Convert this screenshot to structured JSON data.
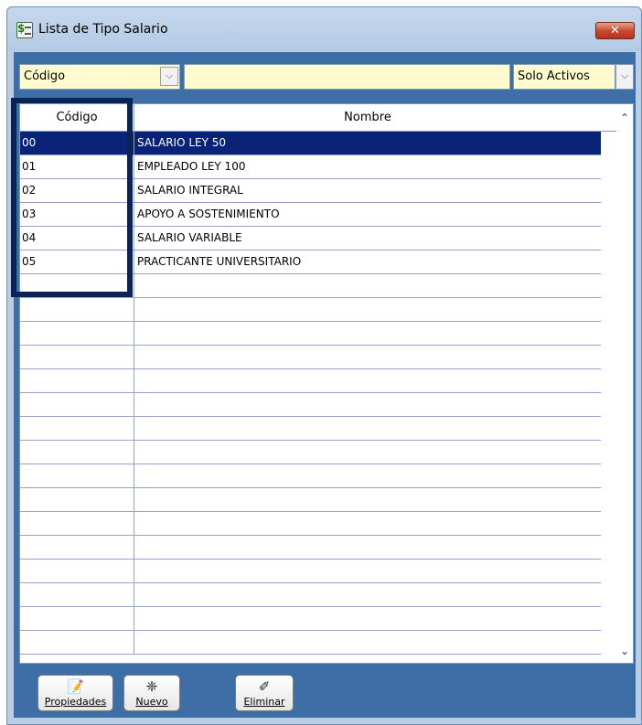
{
  "window": {
    "title": "Lista de Tipo Salario",
    "close_label": "✕"
  },
  "filter": {
    "field_value": "Código",
    "search_value": "",
    "status_value": "Solo Activos"
  },
  "grid": {
    "columns": [
      "Código",
      "Nombre"
    ],
    "rows": [
      {
        "code": "00",
        "name": "SALARIO LEY 50",
        "selected": true
      },
      {
        "code": "01",
        "name": "EMPLEADO LEY 100"
      },
      {
        "code": "02",
        "name": "SALARIO INTEGRAL"
      },
      {
        "code": "03",
        "name": "APOYO A SOSTENIMIENTO"
      },
      {
        "code": "04",
        "name": "SALARIO VARIABLE"
      },
      {
        "code": "05",
        "name": "PRACTICANTE UNIVERSITARIO"
      }
    ],
    "empty_rows": 16
  },
  "toolbar": {
    "properties_label": "Propiedades",
    "new_label": "Nuevo",
    "delete_label": "Eliminar"
  },
  "colors": {
    "selection": "#0b2376",
    "panel": "#3d6fa6",
    "input_bg": "#fffbcf",
    "highlight_box": "#0b2458"
  }
}
